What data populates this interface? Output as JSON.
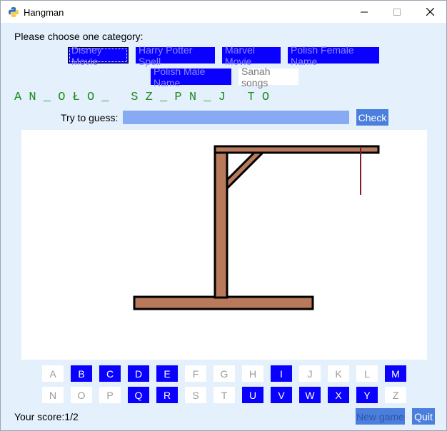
{
  "window": {
    "title": "Hangman",
    "controls": {
      "minimize": "minimize-icon",
      "maximize": "maximize-icon",
      "close": "close-icon"
    }
  },
  "category": {
    "prompt": "Please choose one category:",
    "options": [
      {
        "label": "Disney Movie",
        "state": "selected"
      },
      {
        "label": "Harry Potter Spell",
        "state": "available"
      },
      {
        "label": "Marvel Movie",
        "state": "available"
      },
      {
        "label": "Polish Female Name",
        "state": "available"
      },
      {
        "label": "Polish Male Name",
        "state": "available"
      },
      {
        "label": "Sanah songs",
        "state": "plain"
      }
    ]
  },
  "puzzle": {
    "masked_word": "A N _ O Ł O _   S Z _ P N _ J   T O"
  },
  "guess": {
    "label": "Try to guess:",
    "value": "",
    "check_label": "Check"
  },
  "drawing": {
    "parts": [
      "base",
      "post",
      "beam",
      "brace",
      "rope"
    ],
    "colors": {
      "wood": "#b87a5a",
      "outline": "#000000",
      "rope": "#8a1a2a"
    }
  },
  "keyboard": {
    "row1": [
      {
        "letter": "A",
        "used": false
      },
      {
        "letter": "B",
        "used": true
      },
      {
        "letter": "C",
        "used": true
      },
      {
        "letter": "D",
        "used": true
      },
      {
        "letter": "E",
        "used": true
      },
      {
        "letter": "F",
        "used": false
      },
      {
        "letter": "G",
        "used": false
      },
      {
        "letter": "H",
        "used": false
      },
      {
        "letter": "I",
        "used": true
      },
      {
        "letter": "J",
        "used": false
      },
      {
        "letter": "K",
        "used": false
      },
      {
        "letter": "L",
        "used": false
      },
      {
        "letter": "M",
        "used": true
      }
    ],
    "row2": [
      {
        "letter": "N",
        "used": false
      },
      {
        "letter": "O",
        "used": false
      },
      {
        "letter": "P",
        "used": false
      },
      {
        "letter": "Q",
        "used": true
      },
      {
        "letter": "R",
        "used": true
      },
      {
        "letter": "S",
        "used": false
      },
      {
        "letter": "T",
        "used": false
      },
      {
        "letter": "U",
        "used": true
      },
      {
        "letter": "V",
        "used": true
      },
      {
        "letter": "W",
        "used": true
      },
      {
        "letter": "X",
        "used": true
      },
      {
        "letter": "Y",
        "used": true
      },
      {
        "letter": "Z",
        "used": false
      }
    ]
  },
  "footer": {
    "score_text": "Your score:1/2",
    "new_game_label": "New game",
    "quit_label": "Quit"
  },
  "colors": {
    "window_bg": "#e4f0fc",
    "button_blue": "#0a00ff",
    "action_blue": "#4b7fdd",
    "input_blue": "#88aaf5",
    "word_green": "#1d8c1d"
  }
}
